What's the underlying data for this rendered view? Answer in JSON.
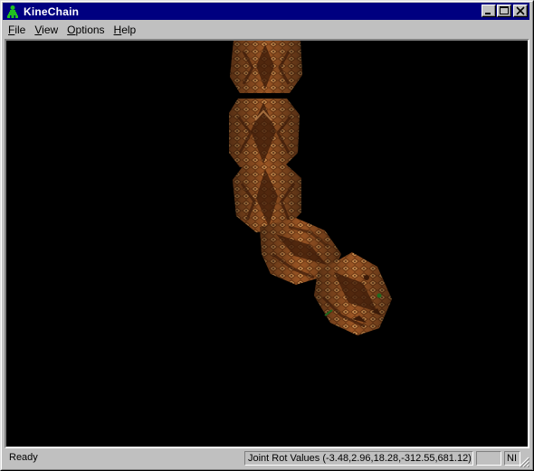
{
  "window": {
    "title": "KineChain",
    "icon": "kinechain-app-icon",
    "controls": {
      "minimize": "minimize-icon",
      "maximize": "maximize-icon",
      "close": "close-icon"
    }
  },
  "menubar": {
    "items": [
      {
        "mnemonic": "F",
        "rest": "ile"
      },
      {
        "mnemonic": "V",
        "rest": "iew"
      },
      {
        "mnemonic": "O",
        "rest": "ptions"
      },
      {
        "mnemonic": "H",
        "rest": "elp"
      }
    ]
  },
  "viewport": {
    "background": "#000000",
    "content": "3D snake-textured kinematic chain of segments"
  },
  "statusbar": {
    "status": "Ready",
    "joint_rot": "Joint Rot Values (-3.48,2.96,18.28,-312.55,681.12)",
    "indicator_blank": "",
    "num_lock": "NI"
  },
  "colors": {
    "title_bar": "#000080",
    "face": "#c0c0c0",
    "snake_dark": "#3a1a08",
    "snake_mid": "#8a4a1e",
    "snake_light": "#c8884a"
  }
}
